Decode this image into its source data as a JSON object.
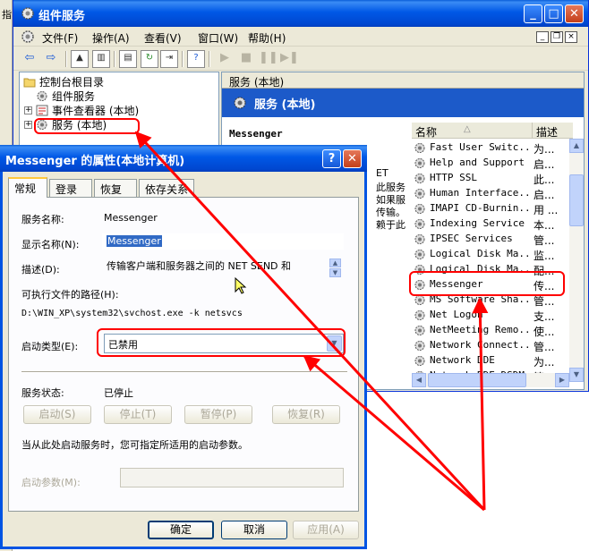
{
  "background_window": {
    "title": "组件服务",
    "menu": [
      "文件(F)",
      "操作(A)",
      "查看(V)",
      "窗口(W)",
      "帮助(H)"
    ],
    "tree": {
      "root": "控制台根目录",
      "items": [
        "组件服务",
        "事件查看器 (本地)",
        "服务 (本地)"
      ]
    },
    "right_pane": {
      "header": "服务 (本地)",
      "banner": "服务 (本地)",
      "selected_service_title": "Messenger",
      "desc_fragments": [
        "ET",
        "此服务",
        "如果服",
        "传输。",
        "赖于此"
      ]
    },
    "list": {
      "columns": [
        "名称",
        "描述"
      ],
      "rows": [
        {
          "name": "Fast User Switc...",
          "desc": "为..."
        },
        {
          "name": "Help and Support",
          "desc": "启..."
        },
        {
          "name": "HTTP SSL",
          "desc": "此..."
        },
        {
          "name": "Human Interface...",
          "desc": "启..."
        },
        {
          "name": "IMAPI CD-Burnin...",
          "desc": "用 ..."
        },
        {
          "name": "Indexing Service",
          "desc": "本..."
        },
        {
          "name": "IPSEC Services",
          "desc": "管..."
        },
        {
          "name": "Logical Disk Ma...",
          "desc": "监..."
        },
        {
          "name": "Logical Disk Ma...",
          "desc": "配..."
        },
        {
          "name": "Messenger",
          "desc": "传..."
        },
        {
          "name": "MS Software Sha...",
          "desc": "管..."
        },
        {
          "name": "Net Logon",
          "desc": "支..."
        },
        {
          "name": "NetMeeting Remo...",
          "desc": "使..."
        },
        {
          "name": "Network Connect...",
          "desc": "管..."
        },
        {
          "name": "Network DDE",
          "desc": "为..."
        },
        {
          "name": "Network DDE DSDM",
          "desc": "管..."
        }
      ]
    },
    "left_edge_fragment": "指"
  },
  "dialog": {
    "title": "Messenger 的属性(本地计算机)",
    "tabs": [
      "常规",
      "登录",
      "恢复",
      "依存关系"
    ],
    "service_name_label": "服务名称:",
    "service_name": "Messenger",
    "display_name_label": "显示名称(N):",
    "display_name": "Messenger",
    "description_label": "描述(D):",
    "description": "传输客户端和服务器之间的 NET SEND 和",
    "exe_path_label": "可执行文件的路径(H):",
    "exe_path": "D:\\WIN_XP\\system32\\svchost.exe -k netsvcs",
    "startup_type_label": "启动类型(E):",
    "startup_type": "已禁用",
    "status_label": "服务状态:",
    "status_value": "已停止",
    "buttons_service": [
      "启动(S)",
      "停止(T)",
      "暂停(P)",
      "恢复(R)"
    ],
    "hint": "当从此处启动服务时，您可指定所适用的启动参数。",
    "start_params_label": "启动参数(M):",
    "ok": "确定",
    "cancel": "取消",
    "apply": "应用(A)"
  },
  "colors": {
    "title_blue": "#0058e6",
    "annotation_red": "#ff0000",
    "banner_blue": "#1c5ac9"
  }
}
